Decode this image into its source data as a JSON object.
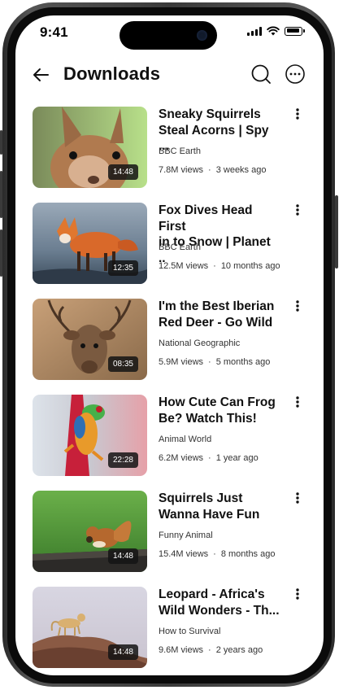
{
  "status_bar": {
    "time": "9:41"
  },
  "header": {
    "title": "Downloads"
  },
  "videos": [
    {
      "title_line1": "Sneaky Squirrels",
      "title_line2": "Steal Acorns | Spy ...",
      "channel": "BBC Earth",
      "views": "7.8M views",
      "age": "3 weeks ago",
      "duration": "14:48"
    },
    {
      "title_line1": "Fox Dives Head First",
      "title_line2": "in to Snow | Planet ..",
      "channel": "BBC Earth",
      "views": "12.5M views",
      "age": "10 months ago",
      "duration": "12:35"
    },
    {
      "title_line1": "I'm the Best Iberian",
      "title_line2": "Red Deer - Go Wild",
      "channel": "National Geographic",
      "views": "5.9M views",
      "age": "5 months ago",
      "duration": "08:35"
    },
    {
      "title_line1": "How Cute Can Frog",
      "title_line2": "Be? Watch This!",
      "channel": "Animal World",
      "views": "6.2M views",
      "age": "1 year ago",
      "duration": "22:28"
    },
    {
      "title_line1": "Squirrels Just",
      "title_line2": "Wanna Have Fun",
      "channel": "Funny Animal",
      "views": "15.4M views",
      "age": "8 months ago",
      "duration": "14:48"
    },
    {
      "title_line1": "Leopard - Africa's",
      "title_line2": "Wild Wonders - Th...",
      "channel": "How to Survival",
      "views": "9.6M views",
      "age": "2 years ago",
      "duration": "14:48"
    }
  ],
  "icons": {
    "back": "arrow-left-icon",
    "search": "search-icon",
    "more": "more-horizontal-icon",
    "item_menu": "more-vertical-icon"
  }
}
